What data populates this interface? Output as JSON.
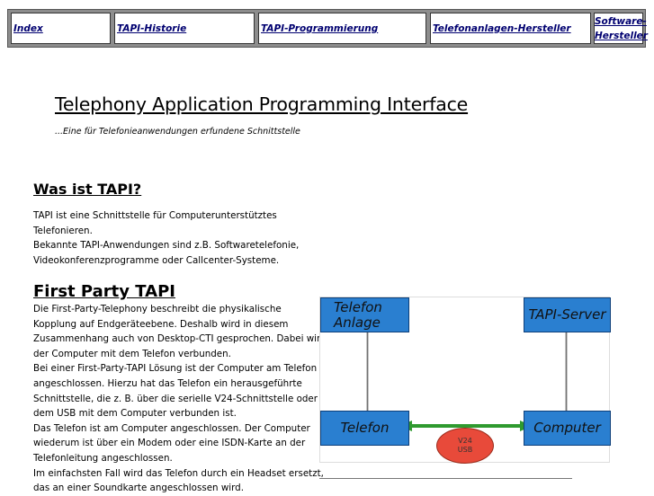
{
  "nav": {
    "items": [
      {
        "label": "Index"
      },
      {
        "label": "TAPI-Historie"
      },
      {
        "label": "TAPI-Programmierung"
      },
      {
        "label": "Telefonanlagen-Hersteller"
      },
      {
        "label_line1": "Software-",
        "label_line2": "Hersteller"
      }
    ]
  },
  "page": {
    "title": "Telephony Application Programming Interface",
    "subtitle": "...Eine für Telefonieanwendungen erfundene Schnittstelle"
  },
  "sections": [
    {
      "heading": "Was ist TAPI?",
      "lines": [
        "TAPI ist eine Schnittstelle für Computerunterstütztes",
        "Telefonieren.",
        "Bekannte TAPI-Anwendungen sind z.B. Softwaretelefonie,",
        "Videokonferenzprogramme oder Callcenter-Systeme."
      ]
    },
    {
      "heading": "First Party TAPI",
      "lines": [
        "Die First-Party-Telephony beschreibt die physikalische",
        "Kopplung auf Endgeräteebene. Deshalb wird in diesem",
        "Zusammenhang auch von Desktop-CTI gesprochen. Dabei wird",
        "der Computer mit dem Telefon verbunden.",
        "Bei einer First-Party-TAPI Lösung ist der Computer am Telefon",
        "angeschlossen. Hierzu hat das Telefon ein herausgeführte",
        "Schnittstelle, die z. B. über die serielle V24-Schnittstelle  oder",
        "dem USB mit dem Computer verbunden ist.",
        "Das Telefon ist am Computer angeschlossen. Der Computer",
        "wiederum ist über ein Modem  oder eine ISDN-Karte an der",
        "Telefonleitung angeschlossen.",
        "Im einfachsten Fall wird das Telefon durch ein Headset ersetzt,",
        "das an einer Soundkarte angeschlossen wird."
      ]
    }
  ],
  "diagram": {
    "box_telefonanlage_line1": "Telefon",
    "box_telefonanlage_line2": "Anlage",
    "box_tapi_server": "TAPI-Server",
    "box_telefon": "Telefon",
    "box_computer": "Computer",
    "link_line1": "V24",
    "link_line2": "USB",
    "colors": {
      "box": "#2a7fd0",
      "link": "#e84a3a",
      "connector": "#2f9a2f"
    }
  }
}
